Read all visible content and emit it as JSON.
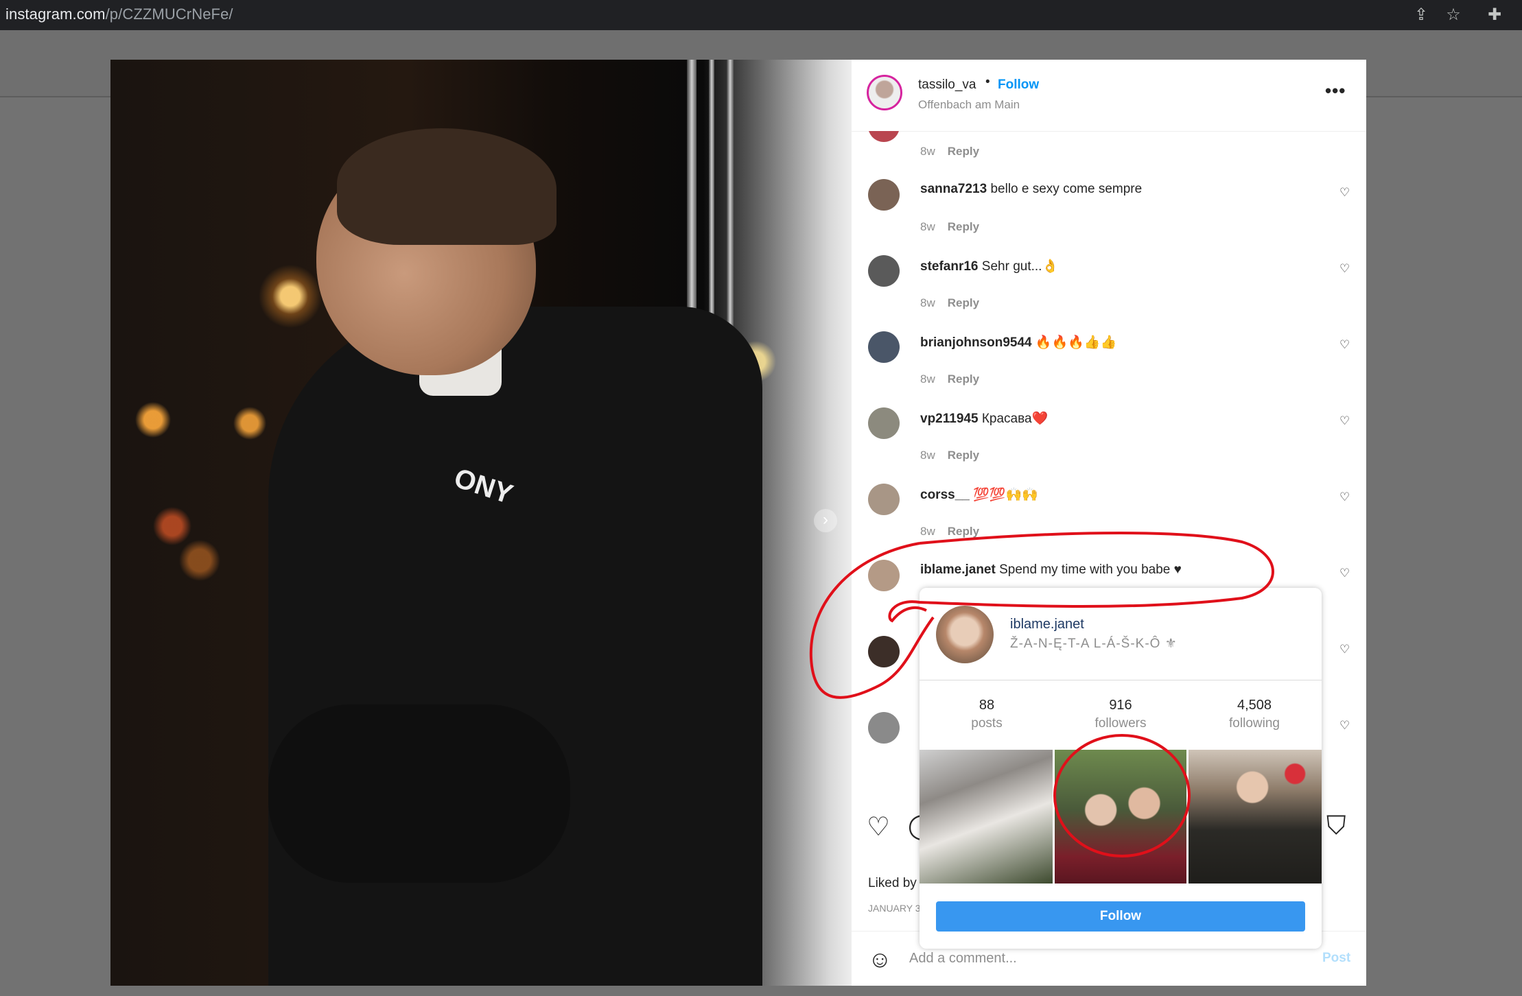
{
  "browser": {
    "url_host": "instagram.com",
    "url_path": "/p/CZZMUCrNeFe/"
  },
  "post": {
    "username": "tassilo_va",
    "separator": "•",
    "follow_label": "Follow",
    "location": "Offenbach am Main",
    "more_label": "•••",
    "photo_print_text": "ONY",
    "liked_by": "Liked by",
    "date": "JANUARY 3",
    "add_comment_placeholder": "Add a comment...",
    "post_label": "Post"
  },
  "comments": [
    {
      "user": "",
      "text": "",
      "age": "8w",
      "reply": "Reply"
    },
    {
      "user": "sanna7213",
      "text": "bello e sexy come sempre",
      "age": "8w",
      "reply": "Reply"
    },
    {
      "user": "stefanr16",
      "text": "Sehr gut...👌",
      "age": "8w",
      "reply": "Reply"
    },
    {
      "user": "brianjohnson9544",
      "text": "🔥🔥🔥👍👍",
      "age": "8w",
      "reply": "Reply"
    },
    {
      "user": "vp211945",
      "text": "Красава❤️",
      "age": "8w",
      "reply": "Reply"
    },
    {
      "user": "corss__",
      "text": "💯💯🙌🙌",
      "age": "8w",
      "reply": "Reply"
    },
    {
      "user": "iblame.janet",
      "text": "Spend my time with you babe ♥",
      "age": "",
      "reply": ""
    }
  ],
  "hover_card": {
    "username": "iblame.janet",
    "full_name": "Ž-A-N-Ę-T-A L-Á-Š-K-Ô ⚜",
    "posts_count": "88",
    "posts_label": "posts",
    "followers_count": "916",
    "followers_label": "followers",
    "following_count": "4,508",
    "following_label": "following",
    "follow_button": "Follow"
  },
  "colors": {
    "follow_blue": "#0095f6",
    "button_blue": "#3897f0",
    "annotation_red": "#e0101a"
  }
}
